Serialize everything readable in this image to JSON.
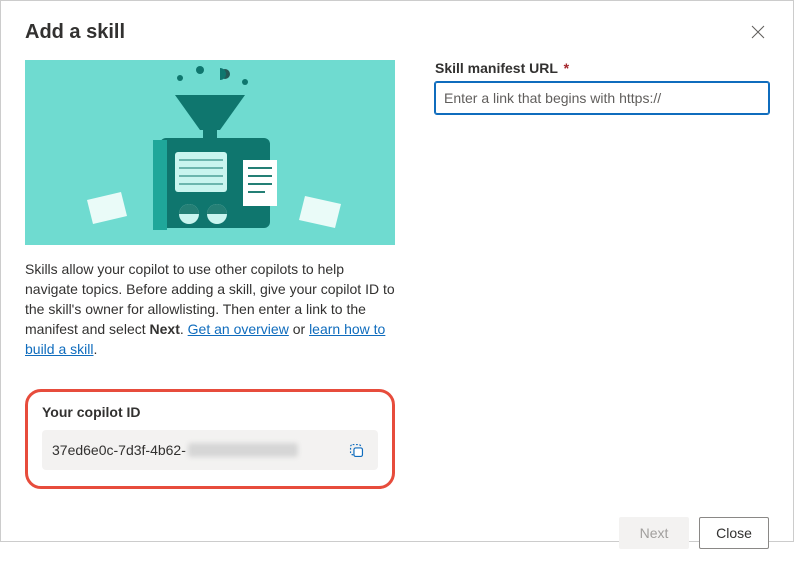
{
  "dialog": {
    "title": "Add a skill"
  },
  "description": {
    "text_pre": "Skills allow your copilot to use other copilots to help navigate topics. Before adding a skill, give your copilot ID to the skill's owner for allowlisting. Then enter a link to the manifest and select ",
    "next_bold": "Next",
    "period": ". ",
    "link1": "Get an overview",
    "or_text": " or ",
    "link2": "learn how to build a skill",
    "end_period": "."
  },
  "copilot_id": {
    "label": "Your copilot ID",
    "value_prefix": "37ed6e0c-7d3f-4b62-"
  },
  "skill_url": {
    "label": "Skill manifest URL",
    "required_marker": "*",
    "placeholder": "Enter a link that begins with https://",
    "value": ""
  },
  "footer": {
    "next": "Next",
    "close": "Close"
  }
}
